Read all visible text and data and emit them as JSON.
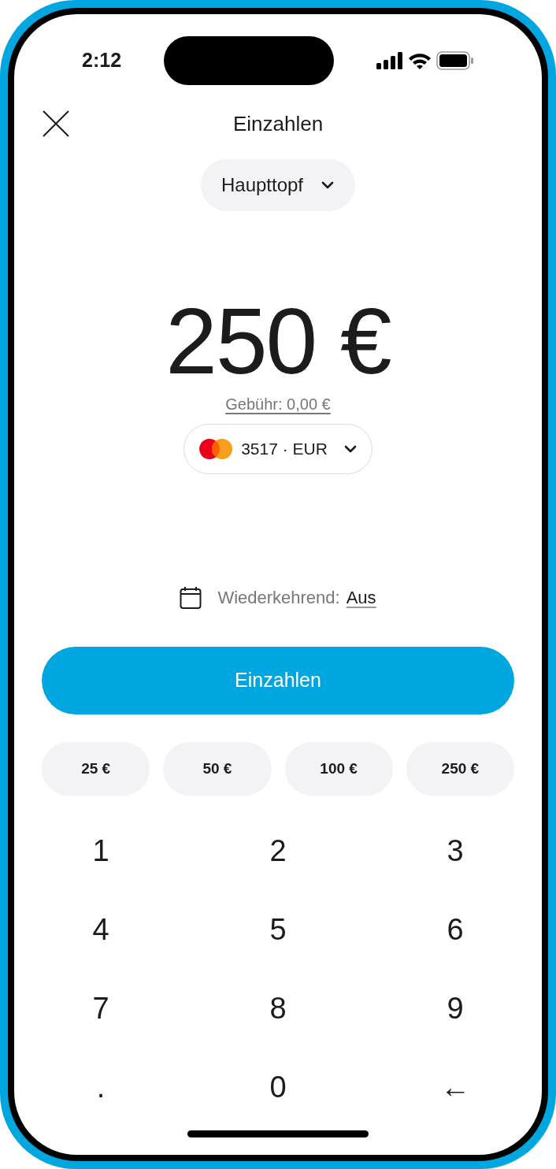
{
  "status_bar": {
    "time": "2:12"
  },
  "header": {
    "title": "Einzahlen"
  },
  "pot_selector": {
    "label": "Haupttopf"
  },
  "amount": "250 €",
  "fee": "Gebühr: 0,00 €",
  "card_selector": {
    "label": "3517 · EUR"
  },
  "recurring": {
    "label": "Wiederkehrend:",
    "value": "Aus"
  },
  "primary_button": "Einzahlen",
  "quick_amounts": [
    "25 €",
    "50 €",
    "100 €",
    "250 €"
  ],
  "keypad": [
    "1",
    "2",
    "3",
    "4",
    "5",
    "6",
    "7",
    "8",
    "9",
    ".",
    "0",
    "←"
  ]
}
